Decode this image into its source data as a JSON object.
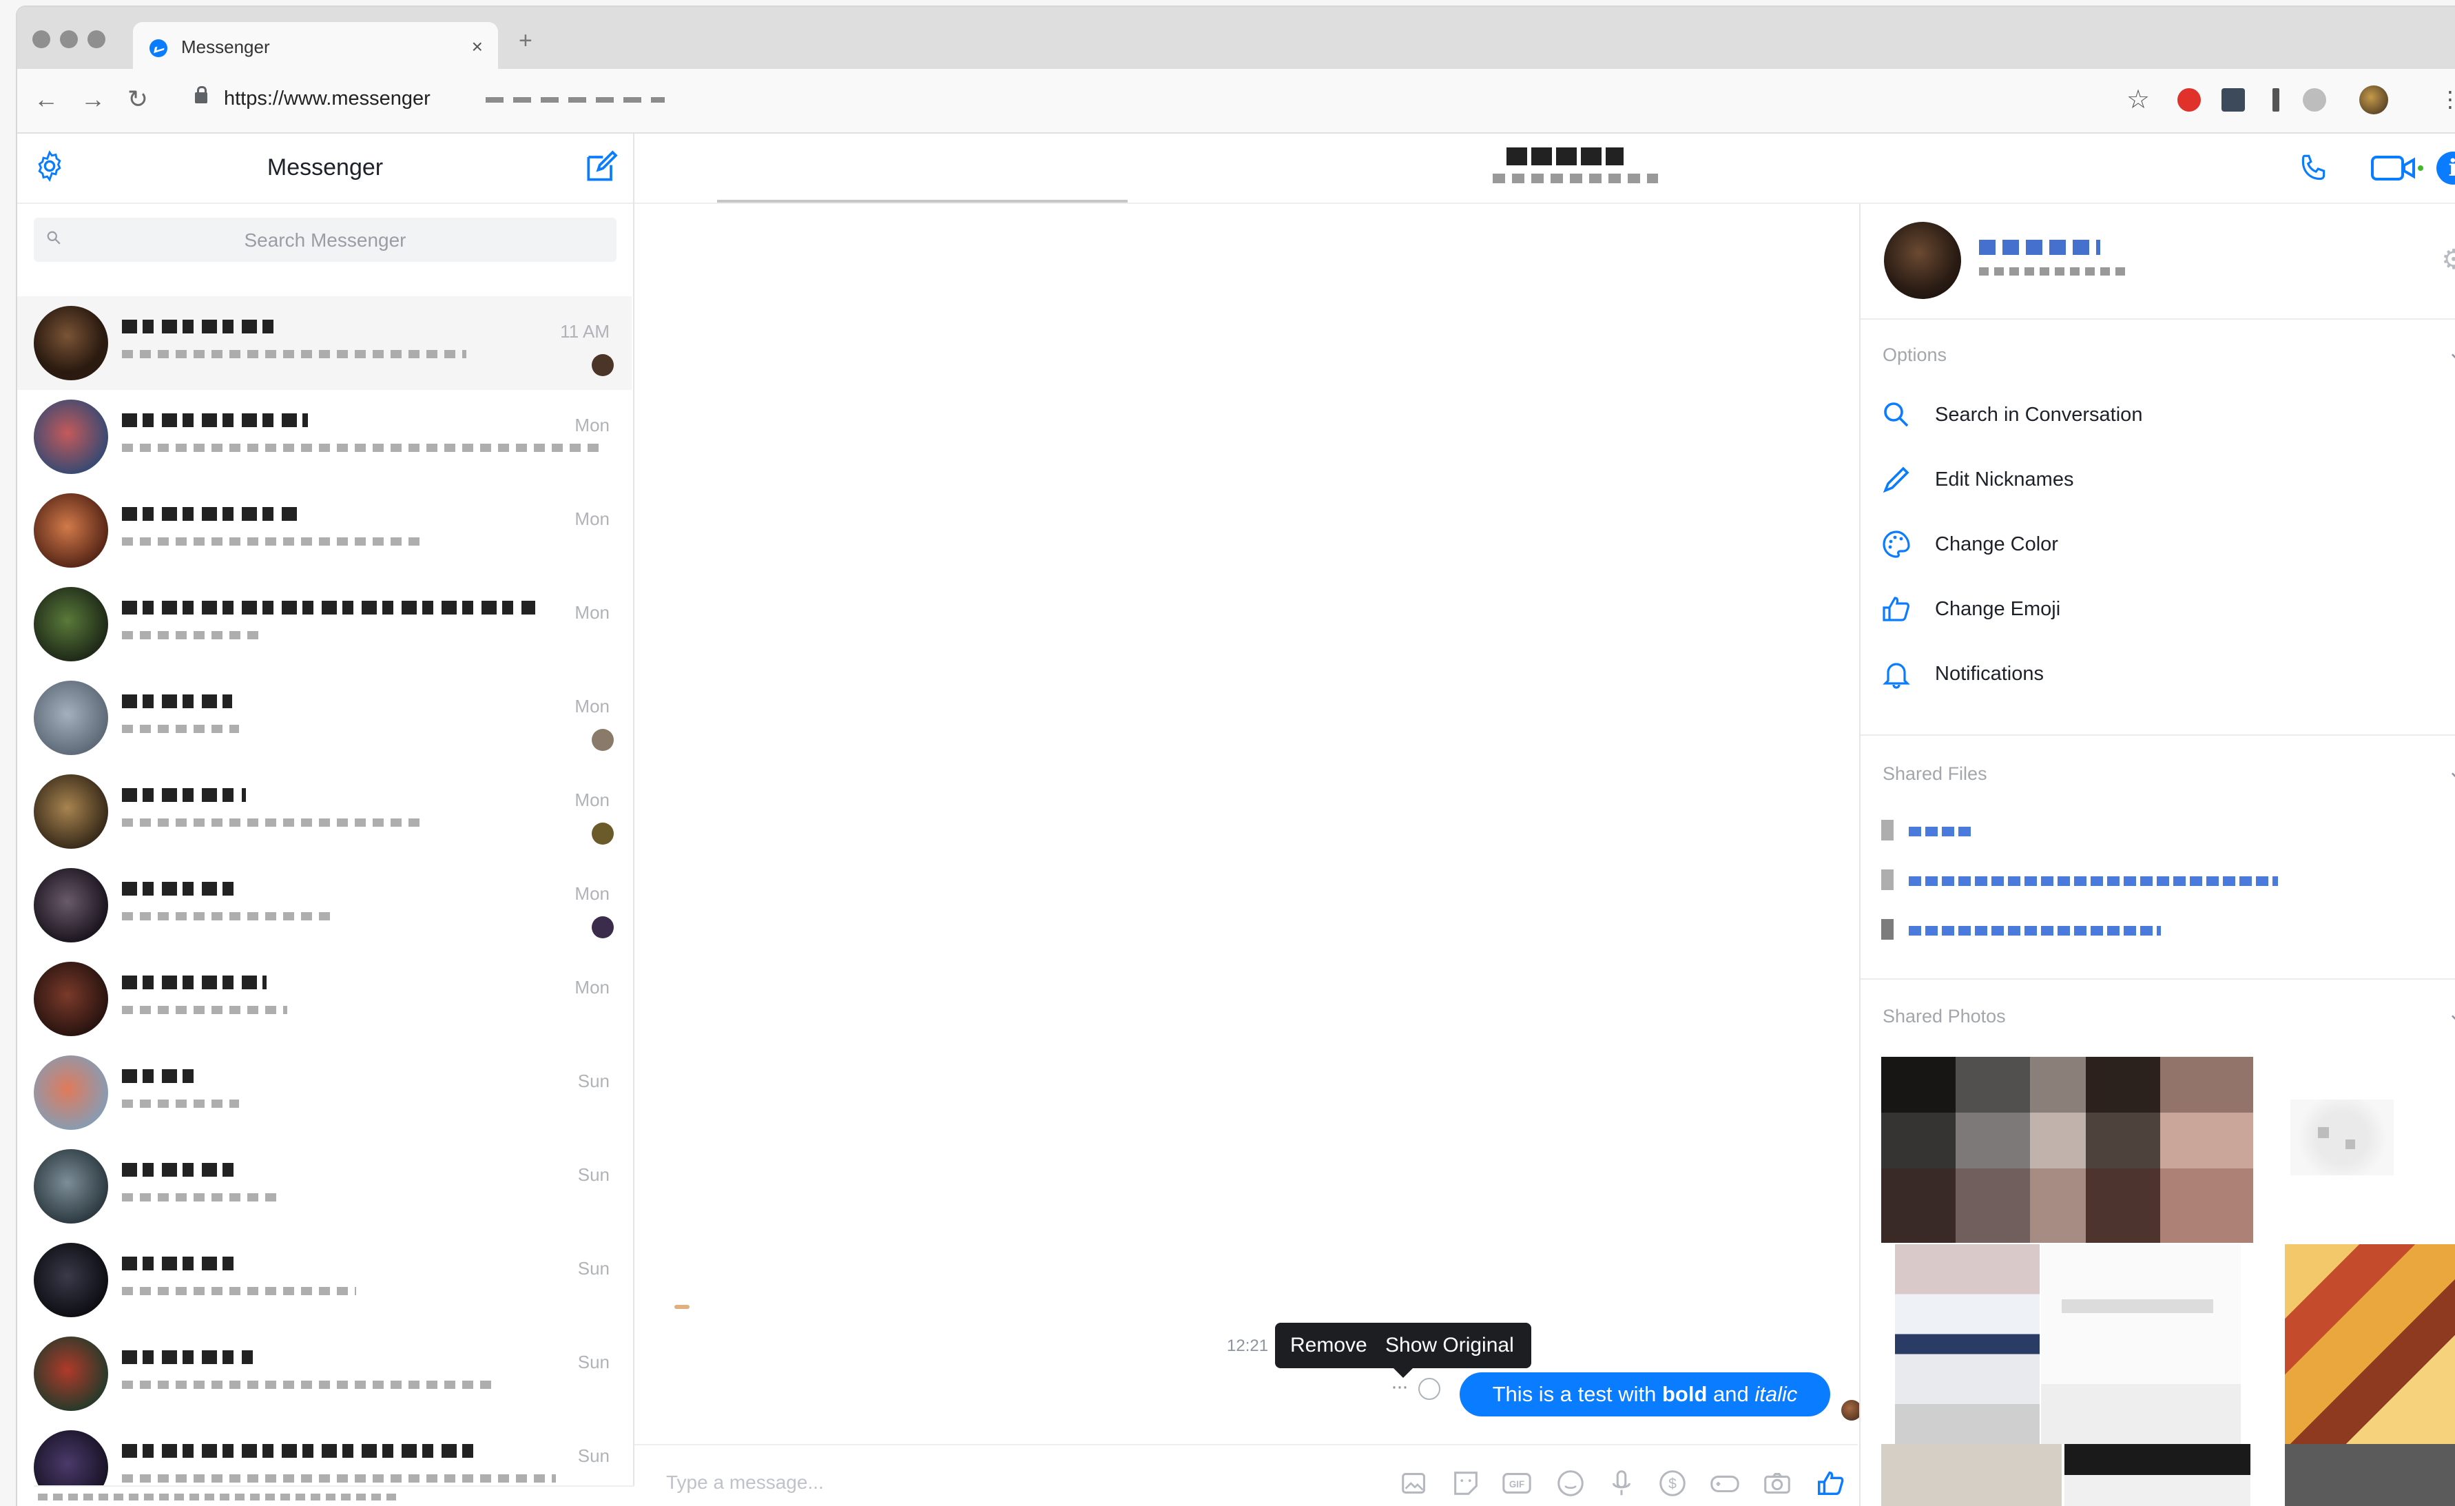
{
  "browser": {
    "tab_title": "Messenger",
    "tab_close": "×",
    "new_tab": "+",
    "url": "https://www.messenger",
    "back": "←",
    "forward": "→",
    "reload": "↻",
    "bookmark": "☆"
  },
  "sidebar": {
    "title": "Messenger",
    "search_placeholder": "Search Messenger",
    "conversations": [
      {
        "time": "11 AM",
        "active": true
      },
      {
        "time": "Mon"
      },
      {
        "time": "Mon"
      },
      {
        "time": "Mon"
      },
      {
        "time": "Mon"
      },
      {
        "time": "Mon"
      },
      {
        "time": "Mon"
      },
      {
        "time": "Mon"
      },
      {
        "time": "Sun"
      },
      {
        "time": "Sun"
      },
      {
        "time": "Sun"
      },
      {
        "time": "Sun"
      },
      {
        "time": "Sun"
      }
    ]
  },
  "chat": {
    "message_time": "12:21",
    "tooltip_remove": "Remove",
    "tooltip_show_original": "Show Original",
    "message_prefix": "This is a test with ",
    "message_bold": "bold",
    "message_mid": " and ",
    "message_italic": "italic",
    "more": "···",
    "composer_placeholder": "Type a message..."
  },
  "info_panel": {
    "options_header": "Options",
    "options": [
      {
        "label": "Search in Conversation",
        "icon": "search-icon"
      },
      {
        "label": "Edit Nicknames",
        "icon": "pencil-icon"
      },
      {
        "label": "Change Color",
        "icon": "palette-icon"
      },
      {
        "label": "Change Emoji",
        "icon": "thumbs-up-icon"
      },
      {
        "label": "Notifications",
        "icon": "bell-icon"
      }
    ],
    "shared_files_header": "Shared Files",
    "shared_photos_header": "Shared Photos"
  },
  "colors": {
    "accent": "#0a7cff",
    "tooltip_bg": "#1c1e21",
    "muted_text": "#a3a6ab"
  }
}
